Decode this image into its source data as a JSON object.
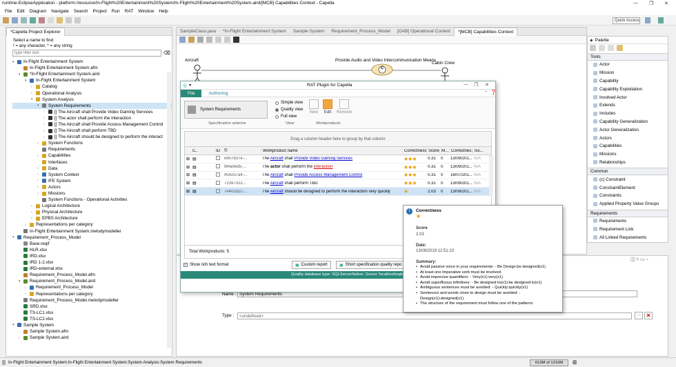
{
  "window": {
    "title": "runtime-EclipseApplication - platform:/resource/In-Flight%20Entertainment%20System/In-Flight%20Entertainment%20System.aird/[MCB] Capabilities Context - Capella"
  },
  "menu": [
    "File",
    "Edit",
    "Diagram",
    "Navigate",
    "Search",
    "Project",
    "Run",
    "RAT",
    "Window",
    "Help"
  ],
  "quick_access": "Quick Access",
  "explorer": {
    "tab": "*Capella Project Explorer",
    "hint1": "Select a name to find",
    "hint2": "! = any character, * = any string",
    "filter_placeholder": "type filter text",
    "items": [
      {
        "d": 0,
        "a": "▾",
        "t": "In-Flight Entertainment System",
        "c": "#3a6fb0"
      },
      {
        "d": 1,
        "a": "",
        "t": "In-Flight Entertainment System.afm",
        "c": "#c08030"
      },
      {
        "d": 1,
        "a": "▾",
        "t": "*In-Flight Entertainment System.aird",
        "c": "#5a8a30"
      },
      {
        "d": 2,
        "a": "▾",
        "t": "In-Flight Entertainment System",
        "c": "#3a6fb0"
      },
      {
        "d": 3,
        "a": "›",
        "t": "Catalog",
        "c": "#d9a520"
      },
      {
        "d": 3,
        "a": "›",
        "t": "Operational Analysis",
        "c": "#d9a520"
      },
      {
        "d": 3,
        "a": "▾",
        "t": "System Analysis",
        "c": "#d9a520"
      },
      {
        "d": 4,
        "a": "▾",
        "t": "System Requirements",
        "c": "#777",
        "sel": true
      },
      {
        "d": 5,
        "a": "›",
        "t": "[] The Aircraft shall Provide Video Gaming Services",
        "c": "#333"
      },
      {
        "d": 5,
        "a": "›",
        "t": "[] The actor shall perform the interaction",
        "c": "#333"
      },
      {
        "d": 5,
        "a": "›",
        "t": "[] The Aircraft shall Provide Access Management Control",
        "c": "#333"
      },
      {
        "d": 5,
        "a": "›",
        "t": "[] The Aircraft shall perform TBD",
        "c": "#333"
      },
      {
        "d": 5,
        "a": "›",
        "t": "[] The Aircraft should be designed to perform the interact",
        "c": "#333"
      },
      {
        "d": 4,
        "a": "›",
        "t": "System Functions",
        "c": "#d9a520"
      },
      {
        "d": 4,
        "a": "",
        "t": "Requirements",
        "c": "#777"
      },
      {
        "d": 4,
        "a": "›",
        "t": "Capabilities",
        "c": "#d9a520"
      },
      {
        "d": 4,
        "a": "",
        "t": "Interfaces",
        "c": "#d9a520"
      },
      {
        "d": 4,
        "a": "›",
        "t": "Data",
        "c": "#d9a520"
      },
      {
        "d": 4,
        "a": "›",
        "t": "System Context",
        "c": "#3a6fb0"
      },
      {
        "d": 4,
        "a": "›",
        "t": "IFE System",
        "c": "#3a6fb0"
      },
      {
        "d": 4,
        "a": "›",
        "t": "Actors",
        "c": "#d9a520"
      },
      {
        "d": 4,
        "a": "›",
        "t": "Missions",
        "c": "#d9a520"
      },
      {
        "d": 4,
        "a": "",
        "t": "System Functions - Operational Activities",
        "c": "#777"
      },
      {
        "d": 3,
        "a": "›",
        "t": "Logical Architecture",
        "c": "#d9a520"
      },
      {
        "d": 3,
        "a": "›",
        "t": "Physical Architecture",
        "c": "#d9a520"
      },
      {
        "d": 3,
        "a": "›",
        "t": "EPBS Architecture",
        "c": "#d9a520"
      },
      {
        "d": 2,
        "a": "›",
        "t": "Representations per category",
        "c": "#d9a520"
      },
      {
        "d": 1,
        "a": "",
        "t": "In-Flight Entertainment System.melodymodeller",
        "c": "#777"
      },
      {
        "d": 0,
        "a": "▾",
        "t": "Requirement_Process_Model",
        "c": "#3a6fb0"
      },
      {
        "d": 1,
        "a": "",
        "t": "Base.reqif",
        "c": "#888"
      },
      {
        "d": 1,
        "a": "",
        "t": "HLR.xlsx",
        "c": "#2a7a3a"
      },
      {
        "d": 1,
        "a": "",
        "t": "IRD.xlsx",
        "c": "#2a7a3a"
      },
      {
        "d": 1,
        "a": "",
        "t": "IRD 1-2.xlsx",
        "c": "#2a7a3a"
      },
      {
        "d": 1,
        "a": "",
        "t": "IRD-external.xlsx",
        "c": "#2a7a3a"
      },
      {
        "d": 1,
        "a": "",
        "t": "Requirement_Process_Model.afm",
        "c": "#c08030"
      },
      {
        "d": 1,
        "a": "▾",
        "t": "Requirement_Process_Model.aird",
        "c": "#5a8a30"
      },
      {
        "d": 2,
        "a": "›",
        "t": "Requirement_Process_Model",
        "c": "#3a6fb0"
      },
      {
        "d": 2,
        "a": "›",
        "t": "Representations per category",
        "c": "#d9a520"
      },
      {
        "d": 1,
        "a": "",
        "t": "Requirement_Process_Model.melodymodeller",
        "c": "#777"
      },
      {
        "d": 1,
        "a": "",
        "t": "SRD.xlsx",
        "c": "#2a7a3a"
      },
      {
        "d": 1,
        "a": "",
        "t": "TS-LC1.xlsx",
        "c": "#2a7a3a"
      },
      {
        "d": 1,
        "a": "",
        "t": "TS-LC2.xlsx",
        "c": "#2a7a3a"
      },
      {
        "d": 0,
        "a": "▾",
        "t": "Sample System",
        "c": "#3a6fb0"
      },
      {
        "d": 1,
        "a": "",
        "t": "Sample System.afm",
        "c": "#c08030"
      },
      {
        "d": 1,
        "a": "›",
        "t": "Sample System.aird",
        "c": "#5a8a30"
      }
    ]
  },
  "editor_tabs": [
    "SampleClass.java",
    "*In-Flight Entertainment System",
    "Sample System",
    "Requirement_Process_Model",
    "[OAB] Operational Context",
    "*[MCB] Capabilities Context"
  ],
  "diagram": {
    "actor1": "Aircraft",
    "capability": "Provide Audio and Video Intercommunication Means",
    "actor2": "Cabin Crew",
    "capability_glyph": "C"
  },
  "palette": {
    "title": "Palette",
    "sections": [
      {
        "name": "Tools",
        "items": [
          "Actor",
          "Mission",
          "Capability",
          "Capability Exploitation",
          "Involved Actor",
          "Extends",
          "Includes",
          "Capability Generalization",
          "Actor Generalization",
          "Actors",
          "Capabilities",
          "Missions",
          "Relationships"
        ]
      },
      {
        "name": "Common",
        "items": [
          "(c) Constraint",
          "ConstraintElement",
          "Constraints",
          "Applied Property Value Groups"
        ]
      },
      {
        "name": "Requirements",
        "items": [
          "Requirements",
          "Requirement Link",
          "All Linked Requirements"
        ]
      }
    ]
  },
  "rat": {
    "title": "RAT Plugin for Capella",
    "tabs": [
      "File",
      "Authoring"
    ],
    "spec_label": "System Requirements",
    "spec_group": "Specification selector",
    "views": [
      "Simple view",
      "Quality view",
      "Full view"
    ],
    "view_group": "View",
    "work_buttons": [
      "New",
      "Edit",
      "Remove"
    ],
    "work_group": "Workproducts",
    "group_hint": "Drag a column header here to group by that column",
    "cols": [
      "C..",
      "ID",
      "Workproduct name",
      "Correctness",
      "Score",
      "M...",
      "Correctnes...",
      "Iss..."
    ],
    "rows": [
      {
        "id": "e907837e-...",
        "pre": "The ",
        "l1": "Aircraft",
        "mid": " shall ",
        "l2": "Provide Video Gaming Services",
        "post": "",
        "stars": "★★★",
        "score": "0.31",
        "m": "0",
        "date": "13/09/201...",
        "iss": "N/A",
        "red": false
      },
      {
        "id": "f84a0ed5-...",
        "pre": "The ",
        "l1": "actor",
        "mid": " shall perform the ",
        "l2": "interaction",
        "post": "",
        "stars": "★★★",
        "score": "0.31",
        "m": "0",
        "date": "13/09/201...",
        "iss": "N/A",
        "red": true,
        "bold1": true
      },
      {
        "id": "954257a4-...",
        "pre": "The ",
        "l1": "Aircraft",
        "mid": " shall ",
        "l2": "Provide Access Management Control",
        "post": "",
        "stars": "★★★",
        "score": "0.31",
        "m": "0",
        "date": "16/07/201...",
        "iss": "N/A",
        "red": false
      },
      {
        "id": "72397322...",
        "pre": "The ",
        "l1": "Aircraft",
        "mid": " shall perform TBD",
        "l2": "",
        "post": "",
        "stars": "★★★",
        "score": "0.31",
        "m": "0",
        "date": "13/09/201...",
        "iss": "N/A",
        "red": false
      },
      {
        "id": "7e401d1c-...",
        "pre": "The ",
        "l1": "Aircraft",
        "mid": " should be designed to perform the interaction very quickly",
        "l2": "",
        "post": "",
        "stars": "★",
        "score": "2.03",
        "m": "0",
        "date": "13/09/201...",
        "iss": "N/A",
        "red": false,
        "sel": true
      }
    ],
    "total": "Total Workproducts: 5",
    "rich": "Show rich text format",
    "custom": "Custom report",
    "short": "Short specification quality repo",
    "footer": "Quality database type: SQLServerNative; Server 'localhost\\sqlexpr"
  },
  "popup": {
    "title": "Correctness",
    "stars": "★",
    "score_label": "Score",
    "score": "2.03",
    "date_label": "Date:",
    "date": "13/09/2019 12:51:10",
    "summary_label": "Summary:",
    "items": [
      "Avoid passive voice in your requirements: - Be Design:be designed(x1)",
      "At least one imperative verb must be involved",
      "Avoid imprecise quantifiers: - Very(x1):very(x1)",
      "Avoid superfluous infinitives: - Be designed to(x1):be designed to(x1)",
      "Ambiguous sentences must be avoided: - Quickly:quickly(x1)",
      "Sentences and words close to design must be avoided: - Design(x1):designed(x1)",
      "The structure of the requirement must follow one of the patterns"
    ]
  },
  "props": {
    "name_label": "Name :",
    "name_value": "System Requirements",
    "type_label": "Type :",
    "type_value": "<undefined>"
  },
  "status": {
    "text": "In-Flight Entertainment System:In-Flight Entertainment System:System Analysis:System Requirements",
    "memory": "613M of 1216M"
  }
}
